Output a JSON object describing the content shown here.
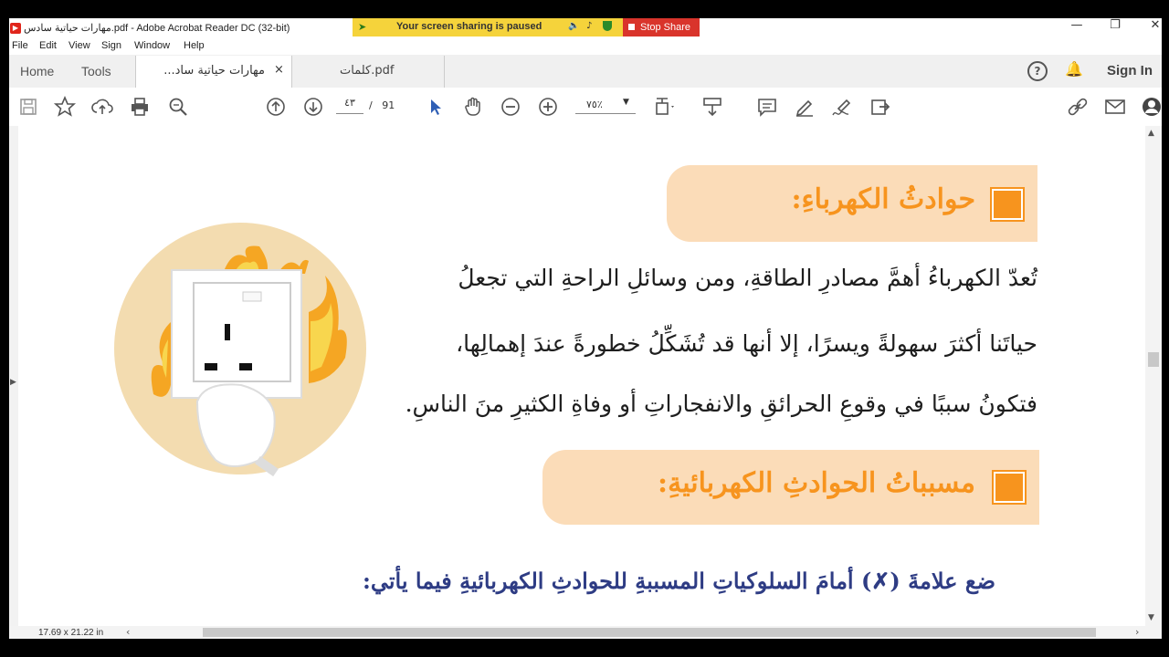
{
  "window": {
    "title": "مهارات حياتية سادس.pdf - Adobe Acrobat Reader DC (32-bit)",
    "controls": [
      "—",
      "❐",
      "✕"
    ]
  },
  "screen_share": {
    "message": "Your screen sharing is paused",
    "stop_label": "Stop Share"
  },
  "menu": [
    "File",
    "Edit",
    "View",
    "Sign",
    "Window",
    "Help"
  ],
  "tabs": {
    "home": "Home",
    "tools": "Tools",
    "doc1": "مهارات حياتية ساد...",
    "doc1_close": "×",
    "doc2": "كلمات.pdf",
    "sign_in": "Sign In"
  },
  "toolbar": {
    "page_current": "٤٣",
    "page_separator": "/",
    "page_total": "91",
    "zoom": "٧٥٪",
    "icons": [
      "save-icon",
      "bookmark-star-icon",
      "upload-icon",
      "print-icon",
      "zoom-search-icon",
      "prev-page-icon",
      "next-page-icon",
      "select-arrow-icon",
      "hand-tool-icon",
      "zoom-out-icon",
      "zoom-in-icon",
      "fit-page-icon",
      "scroll-mode-icon",
      "comment-icon",
      "highlight-pen-icon",
      "sign-icon",
      "share-send-icon",
      "link-icon",
      "mail-icon",
      "account-icon"
    ]
  },
  "document": {
    "heading1": "حوادثُ الكهرباءِ:",
    "para_lines": [
      "تُعدّ الكهرباءُ أهمَّ مصادرِ الطاقةِ، ومن وسائلِ الراحةِ التي تجعلُ",
      "حياتَنا أكثرَ سهولةً ويسرًا،  إلا أنها  قد تُشَكِّلُ خطورةً عندَ إهمالِها،",
      "فتكونُ سببًا في وقوعِ الحرائقِ والانفجاراتِ أو وفاةِ الكثيرِ منَ الناسِ."
    ],
    "heading2": "مسبباتُ الحوادثِ الكهربائيةِ:",
    "instruction": "ضع علامةَ (✗) أمامَ السلوكياتِ المسببةِ للحوادثِ الكهربائيةِ فيما يأتي:"
  },
  "status": {
    "page_size": "17.69 x 21.22 in"
  },
  "colors": {
    "accent_orange": "#f7941e",
    "heading_band": "#fbdcb8",
    "instruction_blue": "#2e3c84",
    "share_yellow": "#f5d33b",
    "stop_red": "#d9342b"
  }
}
